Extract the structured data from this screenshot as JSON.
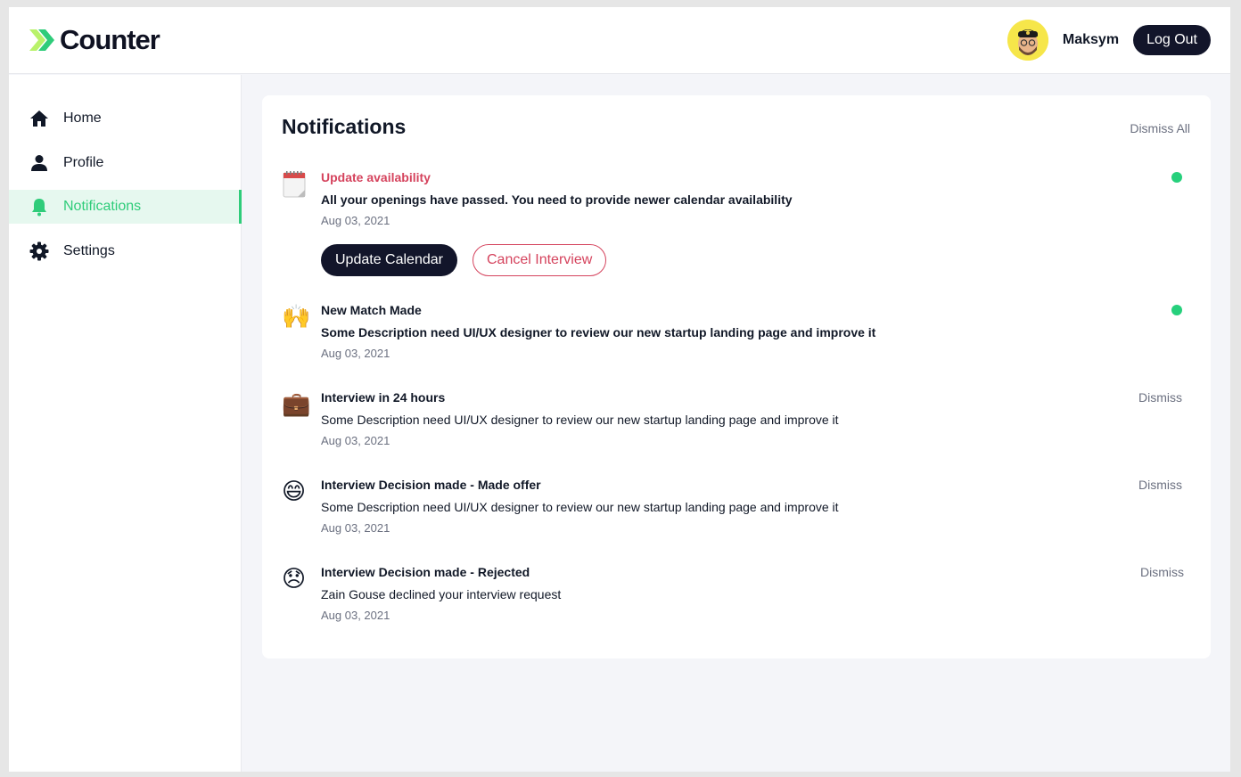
{
  "app": {
    "name": "Counter"
  },
  "header": {
    "username": "Maksym",
    "logout_label": "Log Out"
  },
  "sidebar": {
    "items": [
      {
        "label": "Home",
        "icon": "home-icon",
        "active": false
      },
      {
        "label": "Profile",
        "icon": "user-icon",
        "active": false
      },
      {
        "label": "Notifications",
        "icon": "bell-icon",
        "active": true
      },
      {
        "label": "Settings",
        "icon": "gear-icon",
        "active": false
      }
    ]
  },
  "colors": {
    "accent": "#2fcc7a",
    "dark": "#12152a",
    "alert": "#d5435d",
    "unread_dot": "#26d07c"
  },
  "notifications": {
    "title": "Notifications",
    "dismiss_all_label": "Dismiss All",
    "items": [
      {
        "icon": "calendar-icon",
        "title": "Update availability",
        "description": "All your openings have passed. You need to provide newer calendar availability",
        "date": "Aug 03, 2021",
        "unread": true,
        "primary_action": "Update Calendar",
        "secondary_action": "Cancel Interview"
      },
      {
        "icon": "raised-hands-icon",
        "title": "New Match Made",
        "description": "Some Description need UI/UX designer to review our new startup landing page and improve it",
        "date": "Aug 03, 2021",
        "unread": true
      },
      {
        "icon": "briefcase-icon",
        "title": "Interview in 24 hours",
        "description": "Some Description need UI/UX designer to review our new startup landing page and improve it",
        "date": "Aug 03, 2021",
        "dismiss_label": "Dismiss"
      },
      {
        "icon": "grinning-face-icon",
        "title": "Interview Decision made - Made offer",
        "description": "Some Description need UI/UX designer to review our new startup landing page and improve it",
        "date": "Aug 03, 2021",
        "dismiss_label": "Dismiss"
      },
      {
        "icon": "disappointed-face-icon",
        "title": "Interview Decision made - Rejected",
        "description": "Zain Gouse declined your interview request",
        "date": "Aug 03, 2021",
        "dismiss_label": "Dismiss"
      }
    ]
  }
}
